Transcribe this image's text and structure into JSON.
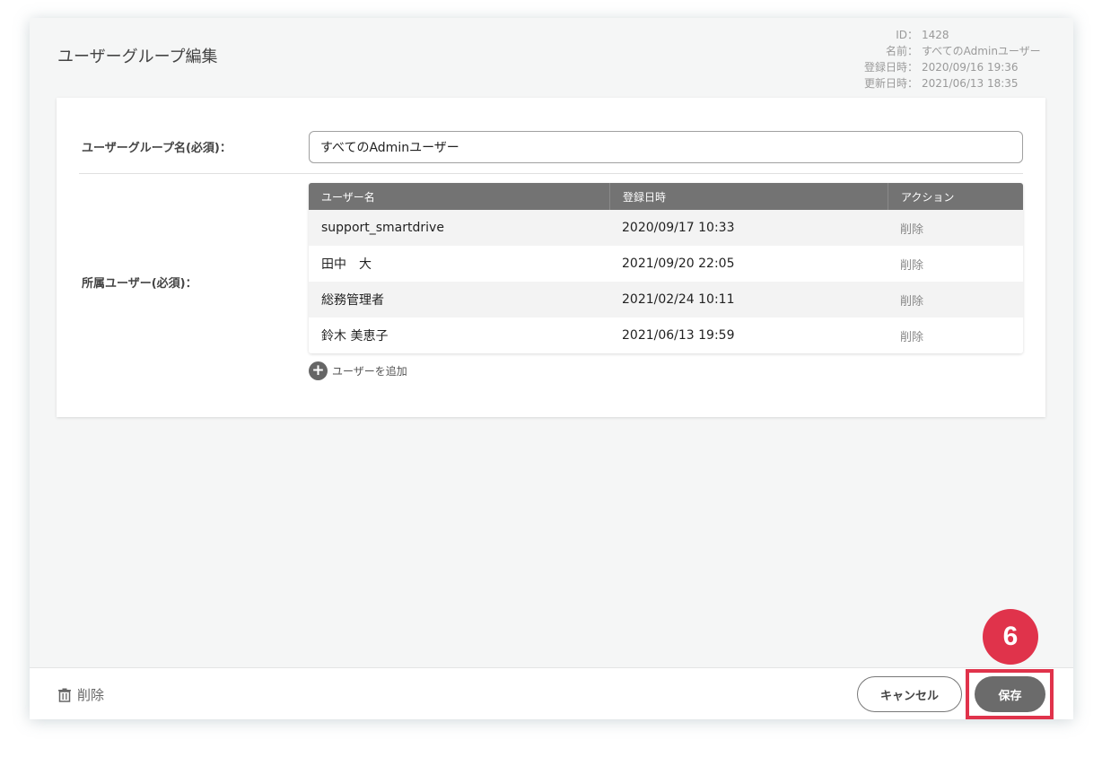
{
  "page": {
    "title": "ユーザーグループ編集"
  },
  "meta": [
    {
      "key": "ID：",
      "value": "1428"
    },
    {
      "key": "名前：",
      "value": "すべてのAdminユーザー"
    },
    {
      "key": "登録日時：",
      "value": "2020/09/16 19:36"
    },
    {
      "key": "更新日時：",
      "value": "2021/06/13 18:35"
    }
  ],
  "form": {
    "group_name_label": "ユーザーグループ名(必須)：",
    "group_name_value": "すべてのAdminユーザー",
    "members_label": "所属ユーザー(必須)：",
    "add_user_label": "ユーザーを追加"
  },
  "table": {
    "headers": [
      "ユーザー名",
      "登録日時",
      "アクション"
    ],
    "rows": [
      {
        "name": "support_smartdrive",
        "date": "2020/09/17 10:33",
        "action": "削除"
      },
      {
        "name": "田中　大",
        "date": "2021/09/20 22:05",
        "action": "削除"
      },
      {
        "name": "総務管理者",
        "date": "2021/02/24 10:11",
        "action": "削除"
      },
      {
        "name": "鈴木 美恵子",
        "date": "2021/06/13 19:59",
        "action": "削除"
      }
    ]
  },
  "footer": {
    "delete_label": "削除",
    "cancel_label": "キャンセル",
    "save_label": "保存"
  },
  "annotation": {
    "step_number": "6"
  },
  "colors": {
    "accent_red": "#e0334b",
    "header_gray": "#737373",
    "save_gray": "#6b6b6b"
  },
  "icons": {
    "delete": "trash-icon",
    "add": "plus-circle-icon"
  }
}
